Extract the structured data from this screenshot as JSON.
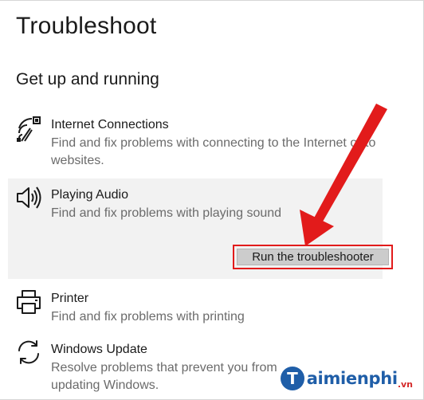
{
  "page": {
    "title": "Troubleshoot",
    "section_title": "Get up and running"
  },
  "items": [
    {
      "icon": "wifi-network-icon",
      "name": "Internet Connections",
      "description": "Find and fix problems with connecting to the Internet or to websites."
    },
    {
      "icon": "speaker-icon",
      "name": "Playing Audio",
      "description": "Find and fix problems with playing sound",
      "selected": true,
      "action_label": "Run the troubleshooter"
    },
    {
      "icon": "printer-icon",
      "name": "Printer",
      "description": "Find and fix problems with printing"
    },
    {
      "icon": "sync-arrows-icon",
      "name": "Windows Update",
      "description": "Resolve problems that prevent you from updating Windows."
    }
  ],
  "annotation": {
    "arrow_color": "#e21b1b",
    "highlight_color": "#e21b1b"
  },
  "watermark": {
    "brand": "aimienphi",
    "brand_initial": "T",
    "domain_suffix": ".vn",
    "color": "#1f5ea8"
  }
}
